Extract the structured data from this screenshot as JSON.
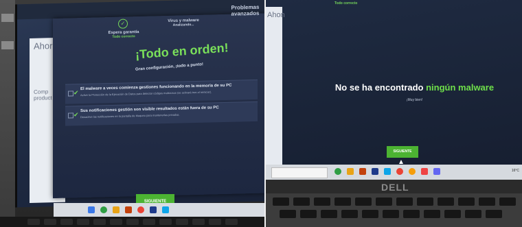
{
  "left_photo": {
    "bg_window_letters": "Ahor",
    "bg_window_side": "Comp\nproduct",
    "steps": {
      "step1": {
        "label": "Espera garantía",
        "status": "Todo correcto"
      },
      "step2": {
        "label": "Virus y malware",
        "status": "Analizando..."
      },
      "step3": {
        "label": "Problemas avanzados"
      }
    },
    "title": "¡Todo en orden!",
    "subtitle": "Gran configuración, ¡todo a punto!",
    "cards": [
      {
        "title": "El malware a veces comienza gestiones funcionando en la memoria de su PC",
        "desc": "Active la Protección de la Ejecución de Datos para detectar códigos maliciosos (se activará tres al reiniciar)."
      },
      {
        "title": "Sus notificaciones gestión son visible resultados están fuera de su PC",
        "desc": "Desactive las notificaciones en la pantalla de bloqueo para mantenerlas privadas."
      }
    ],
    "next_button": "SIGUIENTE"
  },
  "right_photo": {
    "top_status": "Todo correcto",
    "bg_window_letters": "Ahon",
    "title_main": "No se ha encontrado",
    "title_accent": "ningún malware",
    "subtitle": "¡Muy bien!",
    "next_button": "SIGUIENTE",
    "taskbar_temp": "16°C",
    "laptop_logo": "DELL"
  },
  "colors": {
    "accent_green": "#6fe04a",
    "button_green": "#4cb332",
    "panel_dark": "#222c45"
  }
}
